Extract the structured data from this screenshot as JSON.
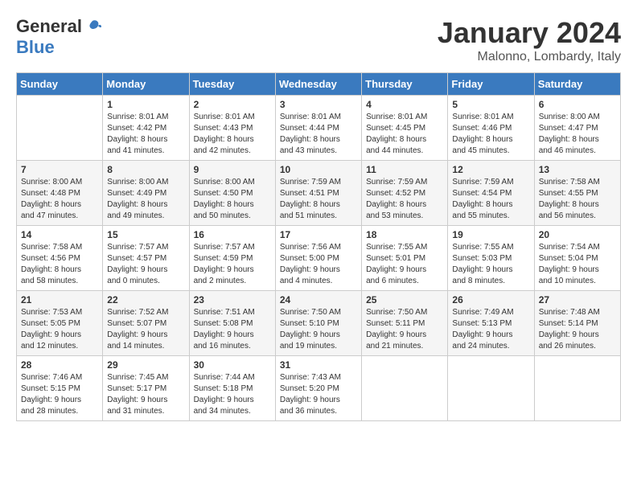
{
  "header": {
    "logo_general": "General",
    "logo_blue": "Blue",
    "month": "January 2024",
    "location": "Malonno, Lombardy, Italy"
  },
  "columns": [
    "Sunday",
    "Monday",
    "Tuesday",
    "Wednesday",
    "Thursday",
    "Friday",
    "Saturday"
  ],
  "weeks": [
    [
      {
        "day": "",
        "info": ""
      },
      {
        "day": "1",
        "info": "Sunrise: 8:01 AM\nSunset: 4:42 PM\nDaylight: 8 hours\nand 41 minutes."
      },
      {
        "day": "2",
        "info": "Sunrise: 8:01 AM\nSunset: 4:43 PM\nDaylight: 8 hours\nand 42 minutes."
      },
      {
        "day": "3",
        "info": "Sunrise: 8:01 AM\nSunset: 4:44 PM\nDaylight: 8 hours\nand 43 minutes."
      },
      {
        "day": "4",
        "info": "Sunrise: 8:01 AM\nSunset: 4:45 PM\nDaylight: 8 hours\nand 44 minutes."
      },
      {
        "day": "5",
        "info": "Sunrise: 8:01 AM\nSunset: 4:46 PM\nDaylight: 8 hours\nand 45 minutes."
      },
      {
        "day": "6",
        "info": "Sunrise: 8:00 AM\nSunset: 4:47 PM\nDaylight: 8 hours\nand 46 minutes."
      }
    ],
    [
      {
        "day": "7",
        "info": "Sunrise: 8:00 AM\nSunset: 4:48 PM\nDaylight: 8 hours\nand 47 minutes."
      },
      {
        "day": "8",
        "info": "Sunrise: 8:00 AM\nSunset: 4:49 PM\nDaylight: 8 hours\nand 49 minutes."
      },
      {
        "day": "9",
        "info": "Sunrise: 8:00 AM\nSunset: 4:50 PM\nDaylight: 8 hours\nand 50 minutes."
      },
      {
        "day": "10",
        "info": "Sunrise: 7:59 AM\nSunset: 4:51 PM\nDaylight: 8 hours\nand 51 minutes."
      },
      {
        "day": "11",
        "info": "Sunrise: 7:59 AM\nSunset: 4:52 PM\nDaylight: 8 hours\nand 53 minutes."
      },
      {
        "day": "12",
        "info": "Sunrise: 7:59 AM\nSunset: 4:54 PM\nDaylight: 8 hours\nand 55 minutes."
      },
      {
        "day": "13",
        "info": "Sunrise: 7:58 AM\nSunset: 4:55 PM\nDaylight: 8 hours\nand 56 minutes."
      }
    ],
    [
      {
        "day": "14",
        "info": "Sunrise: 7:58 AM\nSunset: 4:56 PM\nDaylight: 8 hours\nand 58 minutes."
      },
      {
        "day": "15",
        "info": "Sunrise: 7:57 AM\nSunset: 4:57 PM\nDaylight: 9 hours\nand 0 minutes."
      },
      {
        "day": "16",
        "info": "Sunrise: 7:57 AM\nSunset: 4:59 PM\nDaylight: 9 hours\nand 2 minutes."
      },
      {
        "day": "17",
        "info": "Sunrise: 7:56 AM\nSunset: 5:00 PM\nDaylight: 9 hours\nand 4 minutes."
      },
      {
        "day": "18",
        "info": "Sunrise: 7:55 AM\nSunset: 5:01 PM\nDaylight: 9 hours\nand 6 minutes."
      },
      {
        "day": "19",
        "info": "Sunrise: 7:55 AM\nSunset: 5:03 PM\nDaylight: 9 hours\nand 8 minutes."
      },
      {
        "day": "20",
        "info": "Sunrise: 7:54 AM\nSunset: 5:04 PM\nDaylight: 9 hours\nand 10 minutes."
      }
    ],
    [
      {
        "day": "21",
        "info": "Sunrise: 7:53 AM\nSunset: 5:05 PM\nDaylight: 9 hours\nand 12 minutes."
      },
      {
        "day": "22",
        "info": "Sunrise: 7:52 AM\nSunset: 5:07 PM\nDaylight: 9 hours\nand 14 minutes."
      },
      {
        "day": "23",
        "info": "Sunrise: 7:51 AM\nSunset: 5:08 PM\nDaylight: 9 hours\nand 16 minutes."
      },
      {
        "day": "24",
        "info": "Sunrise: 7:50 AM\nSunset: 5:10 PM\nDaylight: 9 hours\nand 19 minutes."
      },
      {
        "day": "25",
        "info": "Sunrise: 7:50 AM\nSunset: 5:11 PM\nDaylight: 9 hours\nand 21 minutes."
      },
      {
        "day": "26",
        "info": "Sunrise: 7:49 AM\nSunset: 5:13 PM\nDaylight: 9 hours\nand 24 minutes."
      },
      {
        "day": "27",
        "info": "Sunrise: 7:48 AM\nSunset: 5:14 PM\nDaylight: 9 hours\nand 26 minutes."
      }
    ],
    [
      {
        "day": "28",
        "info": "Sunrise: 7:46 AM\nSunset: 5:15 PM\nDaylight: 9 hours\nand 28 minutes."
      },
      {
        "day": "29",
        "info": "Sunrise: 7:45 AM\nSunset: 5:17 PM\nDaylight: 9 hours\nand 31 minutes."
      },
      {
        "day": "30",
        "info": "Sunrise: 7:44 AM\nSunset: 5:18 PM\nDaylight: 9 hours\nand 34 minutes."
      },
      {
        "day": "31",
        "info": "Sunrise: 7:43 AM\nSunset: 5:20 PM\nDaylight: 9 hours\nand 36 minutes."
      },
      {
        "day": "",
        "info": ""
      },
      {
        "day": "",
        "info": ""
      },
      {
        "day": "",
        "info": ""
      }
    ]
  ]
}
